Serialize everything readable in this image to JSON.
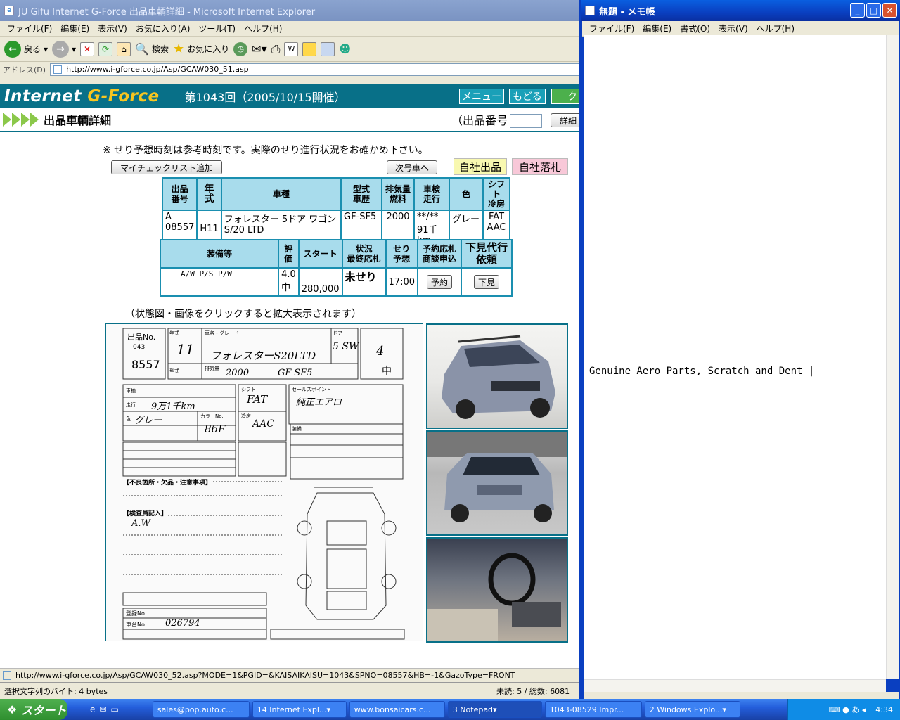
{
  "ie": {
    "title": "JU Gifu Internet G-Force 出品車輌詳細 - Microsoft Internet Explorer",
    "menu": [
      "ファイル(F)",
      "編集(E)",
      "表示(V)",
      "お気に入り(A)",
      "ツール(T)",
      "ヘルプ(H)"
    ],
    "toolbar": {
      "back": "戻る",
      "search": "検索",
      "favorites": "お気に入り"
    },
    "address_label": "アドレス(D)",
    "address": "http://www.i-gforce.co.jp/Asp/GCAW030_51.asp",
    "status_url": "http://www.i-gforce.co.jp/Asp/GCAW030_52.asp?MODE=1&PGID=&KAISAIKAISU=1043&SPNO=08557&HB=-1&GazoType=FRONT"
  },
  "page": {
    "logo_a": "Internet",
    "logo_b": "G-Force",
    "session": "第1043回（2005/10/15開催）",
    "nav": {
      "menu": "メニュー",
      "back": "もどる",
      "third": "ク"
    },
    "subtitle": "出品車輌詳細",
    "lot_label": "（出品番号",
    "detail_btn": "詳細",
    "notice": "※ せり予想時刻は参考時刻です。実際のせり進行状況をお確かめ下さい。",
    "mycheck_btn": "マイチェックリスト追加",
    "next_btn": "次号車へ",
    "own_listing": "自社出品",
    "own_bid": "自社落札",
    "caption": "（状態図・画像をクリックすると拡大表示されます）",
    "table1": {
      "headers": [
        "出品\n番号",
        "年\n式",
        "車種",
        "型式\n車歴",
        "排気量\n燃料",
        "車検\n走行",
        "色",
        "シフト\n冷房"
      ],
      "row": {
        "lot": "A\n08557",
        "year": "H11",
        "model": "フォレスター 5ドア ワゴン S/20 LTD",
        "type": "GF-SF5",
        "cc": "2000",
        "inspect": "**/**\n91千km",
        "color": "グレー",
        "shift": "FAT\nAAC"
      }
    },
    "table2": {
      "headers": [
        "装備等",
        "評\n価",
        "スタート",
        "状況\n最終応札",
        "せり\n予想",
        "予約応札\n商談申込",
        "下見代行\n依頼"
      ],
      "row": {
        "equip": "A/W P/S P/W",
        "grade": "4.0\n中",
        "start": "280,000",
        "status": "未せり",
        "time": "17:00",
        "reserve_btn": "予約",
        "preview_btn": "下見"
      }
    },
    "sheet": {
      "lot_label": "出品No.",
      "lot_small": "043",
      "lot_no": "8557",
      "labels": {
        "nenshiki": "年式",
        "shamei": "車名・グレード",
        "door": "ドア",
        "haikiryo": "排気量",
        "sharekishiki": "型式",
        "shaken": "車検",
        "soko": "走行",
        "iro": "色",
        "colorno": "カラーNo.",
        "shift": "シフト",
        "aircon": "冷房",
        "sales": "セールスポイント",
        "equip": "装備",
        "defects": "【不良箇所・欠品・注意事項】",
        "inspector": "【検査員記入】",
        "touroku": "登録No.",
        "shadai": "車台No."
      },
      "hand": {
        "year": "11",
        "model": "フォレスターS20LTD",
        "door": "5 SW",
        "cc": "2000",
        "type": "GF-SF5",
        "km": "9万1千km",
        "color": "グレー",
        "colorno": "86F",
        "shift": "FAT",
        "aircon": "AAC",
        "sales": "純正エアロ",
        "inspector": "A.W",
        "chassis": "026794",
        "grade": "4",
        "interior": "中"
      }
    }
  },
  "notepad": {
    "title": "無題 - メモ帳",
    "menu": [
      "ファイル(F)",
      "編集(E)",
      "書式(O)",
      "表示(V)",
      "ヘルプ(H)"
    ],
    "text": "Genuine Aero Parts, Scratch and Dent"
  },
  "statusbar2": {
    "left": "選択文字列のバイト: 4 bytes",
    "right": "未読:    5 / 総数: 6081"
  },
  "taskbar": {
    "start": "スタート",
    "items": [
      "sales@pop.auto.c...",
      "14 Internet Expl...",
      "www.bonsaicars.c...",
      "3 Notepad",
      "1043-08529 Impr...",
      "2 Windows Explo..."
    ],
    "clock": "4:34"
  }
}
